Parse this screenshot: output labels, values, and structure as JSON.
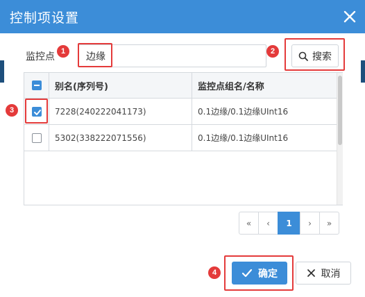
{
  "dialog": {
    "title": "控制项设置"
  },
  "search": {
    "label": "监控点",
    "value": "边缘",
    "button_label": "搜索"
  },
  "table": {
    "headers": {
      "alias": "别名(序列号)",
      "point": "监控点组名/名称"
    },
    "rows": [
      {
        "alias": "7228(240222041173)",
        "point": "0.1边缘/0.1边缘UInt16",
        "checked": true
      },
      {
        "alias": "5302(338222071556)",
        "point": "0.1边缘/0.1边缘UInt16",
        "checked": false
      }
    ]
  },
  "pagination": {
    "first": "«",
    "prev": "‹",
    "current": "1",
    "next": "›",
    "last": "»"
  },
  "footer": {
    "ok_label": "确定",
    "cancel_label": "取消"
  },
  "annotations": {
    "marker1": "1",
    "marker2": "2",
    "marker3": "3",
    "marker4": "4"
  },
  "colors": {
    "accent": "#3c8dd8",
    "marker": "#e43a3a"
  }
}
